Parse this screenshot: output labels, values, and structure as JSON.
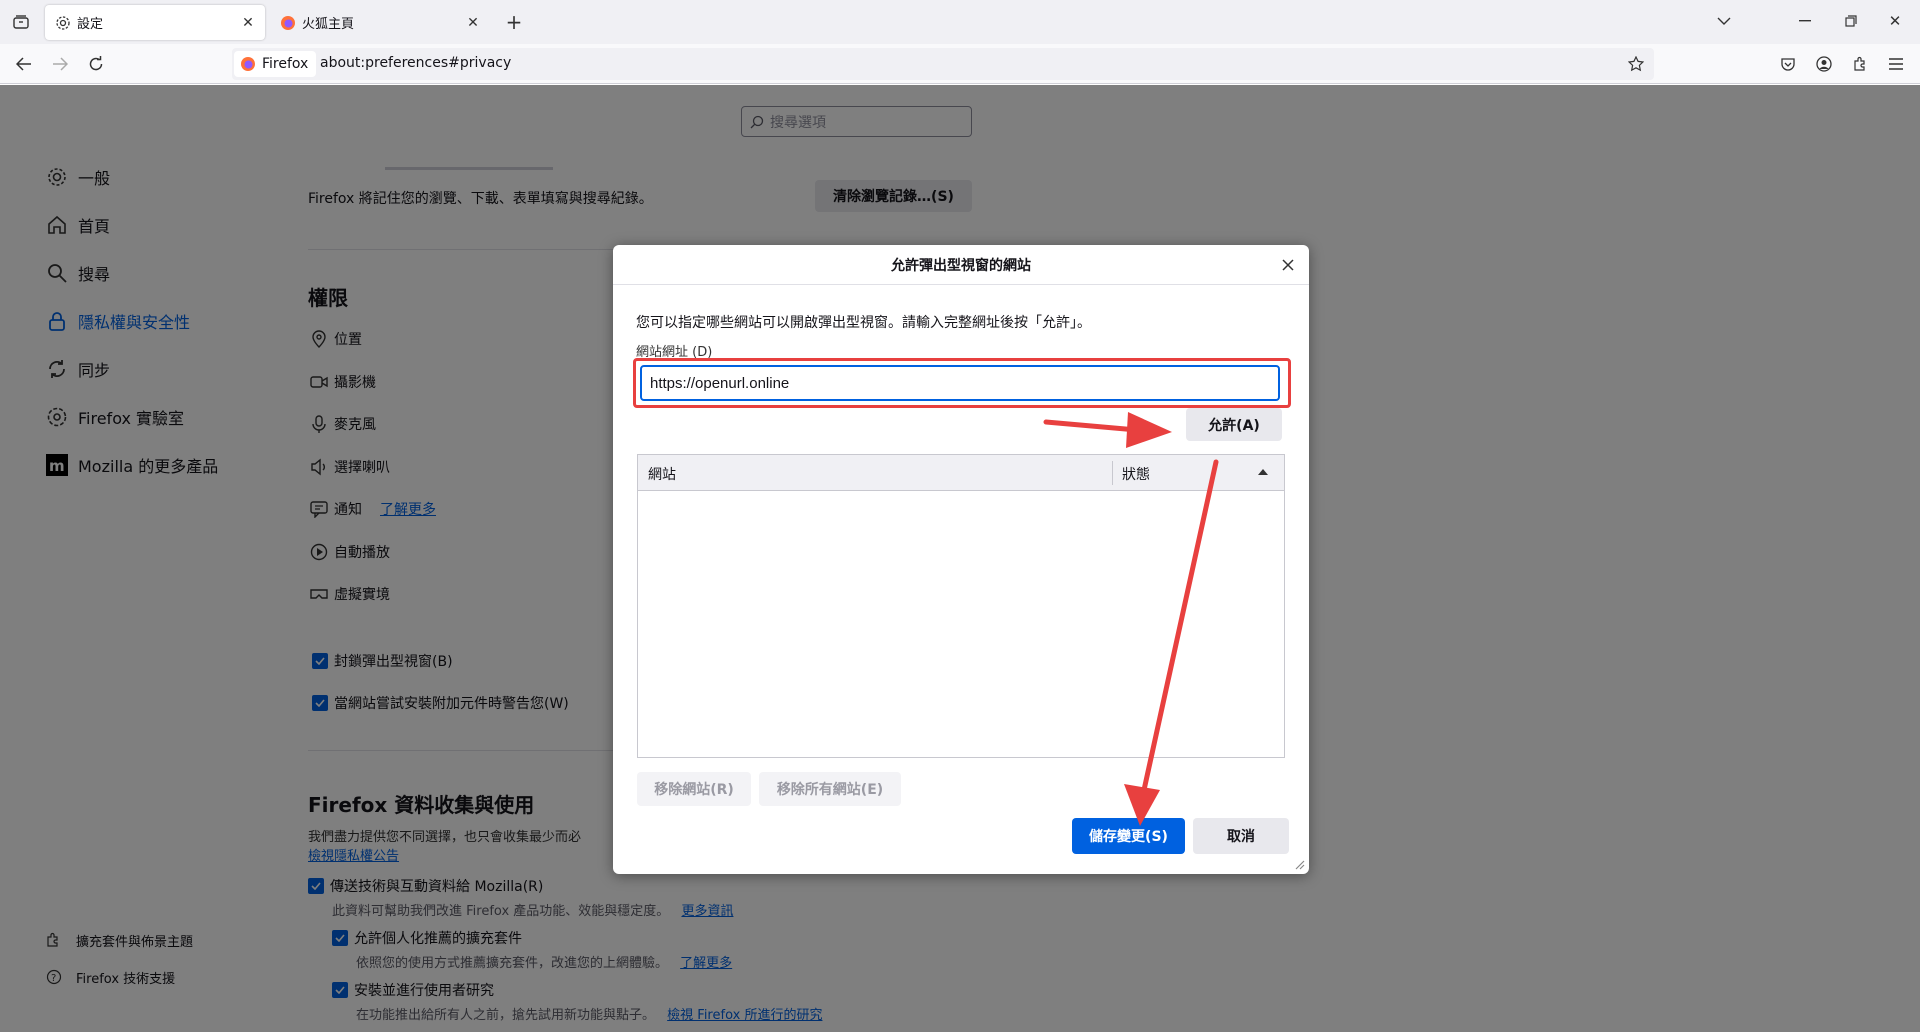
{
  "tabs": [
    {
      "label": "設定",
      "icon": "gear-icon",
      "active": true
    },
    {
      "label": "火狐主頁",
      "icon": "firefox-icon",
      "active": false
    }
  ],
  "navbar": {
    "identity_label": "Firefox",
    "url": "about:preferences#privacy"
  },
  "search": {
    "placeholder": "搜尋選項"
  },
  "sidebar": {
    "items": [
      {
        "label": "一般",
        "icon": "gear-icon"
      },
      {
        "label": "首頁",
        "icon": "home-icon"
      },
      {
        "label": "搜尋",
        "icon": "search-icon"
      },
      {
        "label": "隱私權與安全性",
        "icon": "lock-icon",
        "selected": true
      },
      {
        "label": "同步",
        "icon": "sync-icon"
      },
      {
        "label": "Firefox 實驗室",
        "icon": "flask-icon"
      },
      {
        "label": "Mozilla 的更多產品",
        "icon": "mozilla-icon"
      }
    ],
    "footer": [
      {
        "label": "擴充套件與佈景主題",
        "icon": "puzzle-icon"
      },
      {
        "label": "Firefox 技術支援",
        "icon": "help-icon"
      }
    ]
  },
  "main": {
    "history_text": "Firefox 將記住您的瀏覽、下載、表單填寫與搜尋紀錄。",
    "clear_history_button": "清除瀏覽記錄…(S)",
    "permissions_heading": "權限",
    "permissions": [
      {
        "label": "位置",
        "icon": "location-icon"
      },
      {
        "label": "攝影機",
        "icon": "camera-icon"
      },
      {
        "label": "麥克風",
        "icon": "microphone-icon"
      },
      {
        "label": "選擇喇叭",
        "icon": "speaker-icon"
      },
      {
        "label": "通知",
        "icon": "notification-icon",
        "link": "了解更多"
      },
      {
        "label": "自動播放",
        "icon": "autoplay-icon"
      },
      {
        "label": "虛擬實境",
        "icon": "vr-icon"
      }
    ],
    "block_popups": "封鎖彈出型視窗(B)",
    "warn_addons": "當網站嘗試安裝附加元件時警告您(W)",
    "data_heading": "Firefox 資料收集與使用",
    "data_desc": "我們盡力提供您不同選擇，也只會收集最少而必",
    "privacy_notice_link": "檢視隱私權公告",
    "send_tech": "傳送技術與互動資料給 Mozilla(R)",
    "send_tech_desc": "此資料可幫助我們改進 Firefox 產品功能、效能與穩定度。",
    "send_tech_link": "更多資訊",
    "recommend": "允許個人化推薦的擴充套件",
    "recommend_desc": "依照您的使用方式推薦擴充套件，改進您的上網體驗。",
    "recommend_link": "了解更多",
    "studies": "安裝並進行使用者研究",
    "studies_desc": "在功能推出給所有人之前，搶先試用新功能與點子。",
    "studies_link": "檢視 Firefox 所進行的研究"
  },
  "dialog": {
    "title": "允許彈出型視窗的網站",
    "description": "您可以指定哪些網站可以開啟彈出型視窗。請輸入完整網址後按「允許」。",
    "address_label": "網站網址 (D)",
    "address_value": "https://openurl.online",
    "allow_button": "允許(A)",
    "columns": [
      "網站",
      "狀態"
    ],
    "remove_site": "移除網站(R)",
    "remove_all": "移除所有網站(E)",
    "save_button": "儲存變更(S)",
    "cancel_button": "取消"
  },
  "colors": {
    "accent": "#0061e0",
    "annotation": "#e8403f"
  }
}
